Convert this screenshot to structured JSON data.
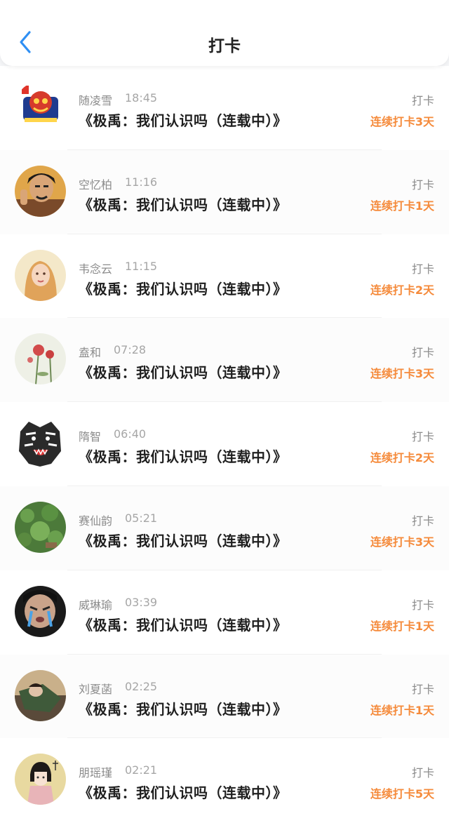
{
  "header": {
    "title": "打卡",
    "back_icon": "chevron-left-icon",
    "accent_color": "#2f8ff3"
  },
  "colors": {
    "streak": "#f58a3a",
    "name": "#8c8c8c",
    "book": "#1f1f1f"
  },
  "items": [
    {
      "name": "随凌雪",
      "time": "18:45",
      "book": "《极禹：我们认识吗（连载中）》",
      "checkin": "打卡",
      "streak": "连续打卡3天"
    },
    {
      "name": "空忆柏",
      "time": "11:16",
      "book": "《极禹：我们认识吗（连载中）》",
      "checkin": "打卡",
      "streak": "连续打卡1天"
    },
    {
      "name": "韦念云",
      "time": "11:15",
      "book": "《极禹：我们认识吗（连载中）》",
      "checkin": "打卡",
      "streak": "连续打卡2天"
    },
    {
      "name": "盍和",
      "time": "07:28",
      "book": "《极禹：我们认识吗（连载中）》",
      "checkin": "打卡",
      "streak": "连续打卡3天"
    },
    {
      "name": "隋智",
      "time": "06:40",
      "book": "《极禹：我们认识吗（连载中）》",
      "checkin": "打卡",
      "streak": "连续打卡2天"
    },
    {
      "name": "赛仙韵",
      "time": "05:21",
      "book": "《极禹：我们认识吗（连载中）》",
      "checkin": "打卡",
      "streak": "连续打卡3天"
    },
    {
      "name": "威琳瑜",
      "time": "03:39",
      "book": "《极禹：我们认识吗（连载中）》",
      "checkin": "打卡",
      "streak": "连续打卡1天"
    },
    {
      "name": "刘夏菡",
      "time": "02:25",
      "book": "《极禹：我们认识吗（连载中）》",
      "checkin": "打卡",
      "streak": "连续打卡1天"
    },
    {
      "name": "朋瑶瑾",
      "time": "02:21",
      "book": "《极禹：我们认识吗（连载中）》",
      "checkin": "打卡",
      "streak": "连续打卡5天"
    }
  ]
}
